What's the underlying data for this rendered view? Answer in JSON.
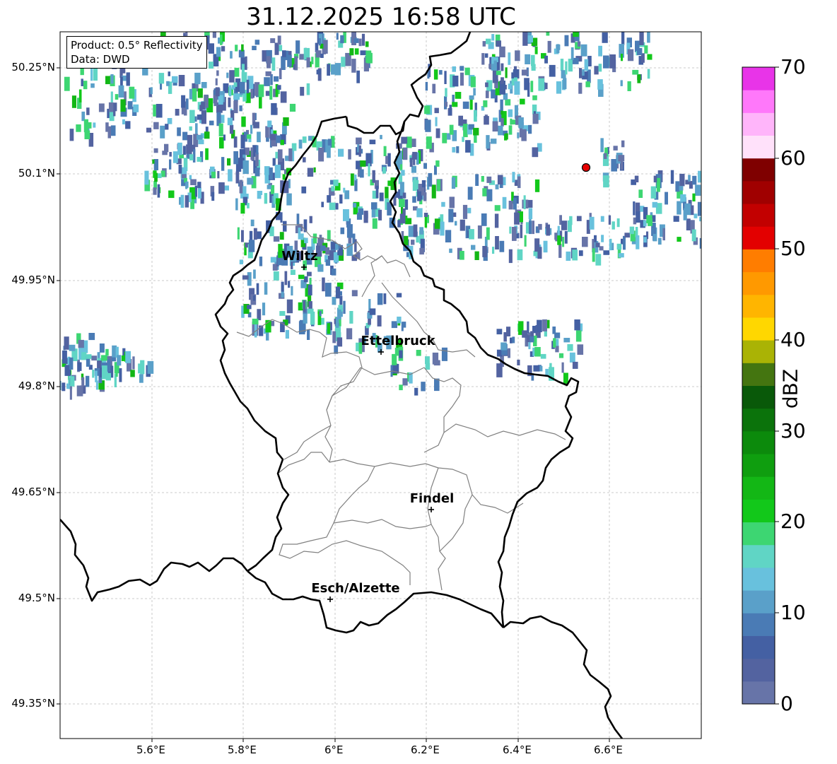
{
  "map": {
    "title": "31.12.2025 16:58 UTC",
    "info": {
      "product": "Product: 0.5° Reflectivity",
      "data": "Data: DWD"
    },
    "lat_ticks": [
      "50.25°N",
      "50.1°N",
      "49.95°N",
      "49.8°N",
      "49.65°N",
      "49.5°N",
      "49.35°N"
    ],
    "lon_ticks": [
      "5.6°E",
      "5.8°E",
      "6°E",
      "6.2°E",
      "6.4°E",
      "6.6°E"
    ],
    "cities": [
      {
        "name": "Wiltz"
      },
      {
        "name": "Ettelbruck"
      },
      {
        "name": "Findel"
      },
      {
        "name": "Esch/Alzette"
      }
    ],
    "colorbar": {
      "label": "dBZ",
      "ticks": [
        "0",
        "10",
        "20",
        "30",
        "40",
        "50",
        "60",
        "70"
      ],
      "colors": [
        "#6774a8",
        "#5363a0",
        "#4460a3",
        "#4a7bb5",
        "#5aa0c9",
        "#68c1dd",
        "#60d5c5",
        "#3dd672",
        "#12c81a",
        "#13b715",
        "#0f9e0f",
        "#0c8a0c",
        "#0b730b",
        "#095909",
        "#447510",
        "#aab305",
        "#ffd700",
        "#ffb500",
        "#ff9900",
        "#ff7d00",
        "#e30000",
        "#c20000",
        "#a00000",
        "#7f0000",
        "#ffe1fa",
        "#ffb5fa",
        "#ff78fa",
        "#e834e8"
      ]
    },
    "colors": {
      "border": "#000000",
      "cantons": "#808080",
      "grid": "#bbbbbb",
      "marker": "#e60000"
    }
  }
}
